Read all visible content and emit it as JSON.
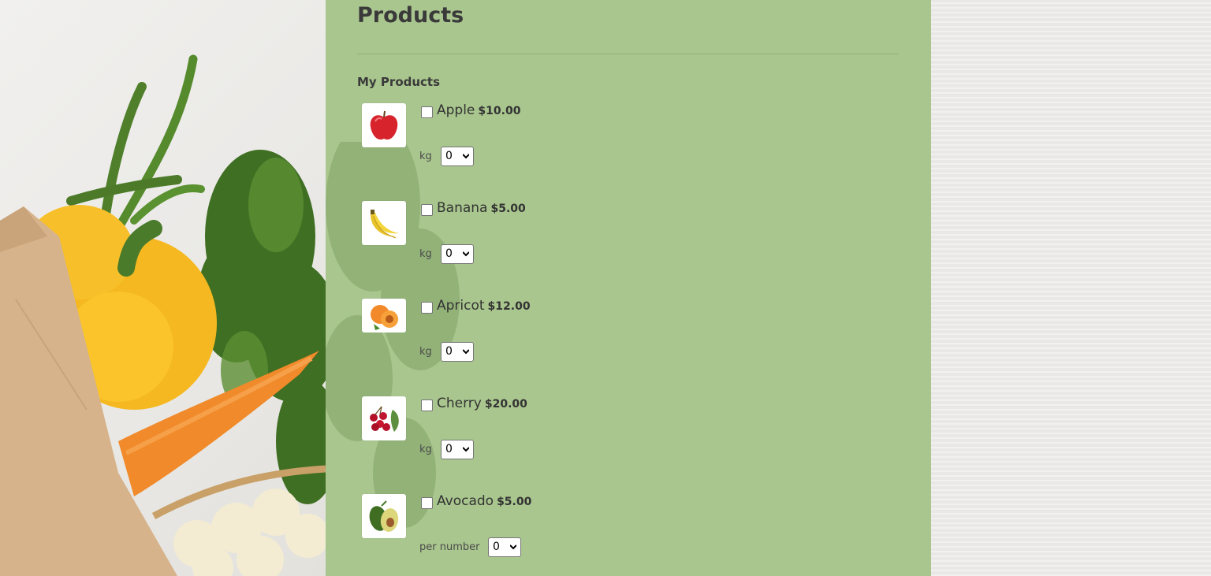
{
  "page": {
    "title": "Products",
    "section_label": "My Products"
  },
  "products": [
    {
      "name": "Apple",
      "price": "$10.00",
      "unit": "kg",
      "quantity": "0",
      "icon": "apple-icon"
    },
    {
      "name": "Banana",
      "price": "$5.00",
      "unit": "kg",
      "quantity": "0",
      "icon": "banana-icon"
    },
    {
      "name": "Apricot",
      "price": "$12.00",
      "unit": "kg",
      "quantity": "0",
      "icon": "apricot-icon"
    },
    {
      "name": "Cherry",
      "price": "$20.00",
      "unit": "kg",
      "quantity": "0",
      "icon": "cherry-icon"
    },
    {
      "name": "Avocado",
      "price": "$5.00",
      "unit": "per number",
      "quantity": "0",
      "icon": "avocado-icon"
    }
  ],
  "colors": {
    "panel": "#a9c68e",
    "divider": "#8fb271",
    "text": "#3a3a3a"
  }
}
